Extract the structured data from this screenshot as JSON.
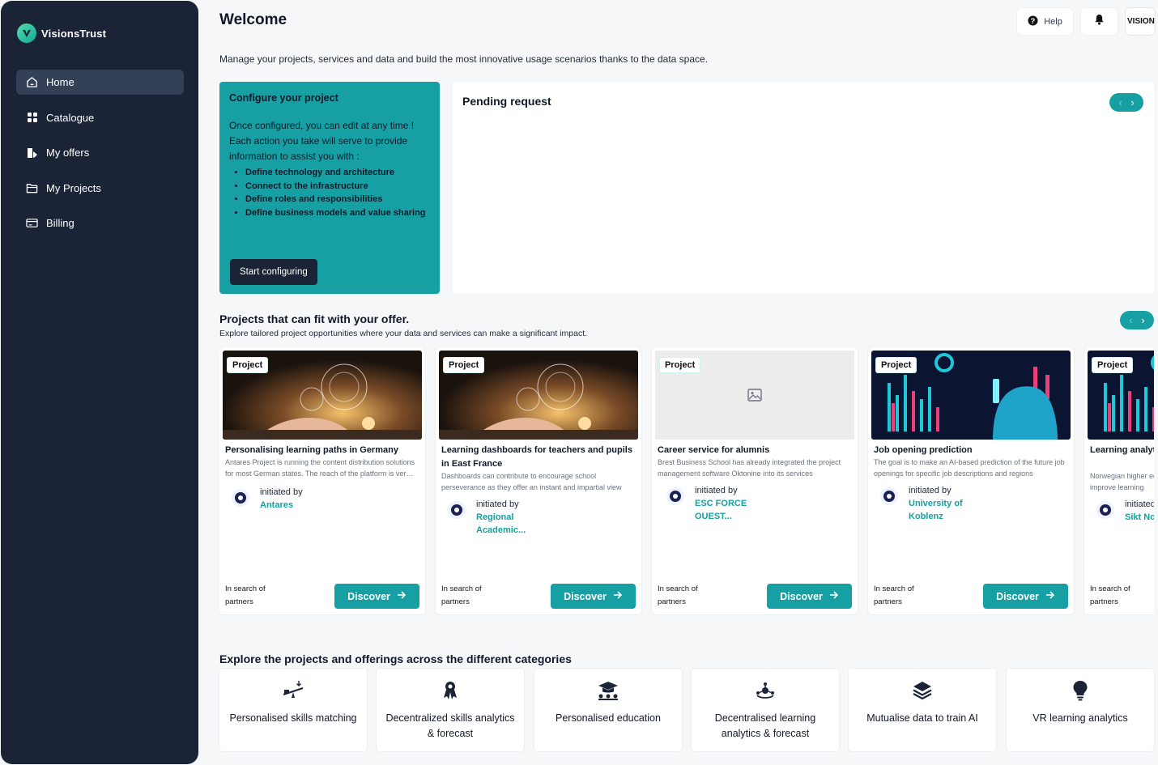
{
  "app": {
    "name": "VisionsTrust"
  },
  "sidebar": {
    "items": [
      {
        "label": "Home",
        "icon": "home-icon"
      },
      {
        "label": "Catalogue",
        "icon": "grid-icon"
      },
      {
        "label": "My offers",
        "icon": "offers-icon"
      },
      {
        "label": "My Projects",
        "icon": "folder-icon"
      },
      {
        "label": "Billing",
        "icon": "billing-icon"
      }
    ],
    "active_index": 0
  },
  "header": {
    "title": "Welcome",
    "subtitle": "Manage your projects, services and data and build the most innovative usage scenarios thanks to the data space.",
    "help_label": "Help",
    "avatar_text": "VISIONS"
  },
  "configure": {
    "title": "Configure your project",
    "text1": "Once configured, you can edit at any time !",
    "text2": "Each action you take will serve to provide information to assist you with :",
    "bullets": [
      "Define technology and architecture",
      "Connect to the infrastructure",
      "Define roles and responsibilities",
      "Define business models and value sharing"
    ],
    "button": "Start configuring"
  },
  "pending": {
    "title": "Pending request"
  },
  "projects": {
    "title": "Projects that can fit with your offer.",
    "subtitle": "Explore tailored project opportunities where your data and services can make a significant impact.",
    "initiated_label": "initiated by",
    "search_label": "In search of partners",
    "discover_label": "Discover",
    "cards": [
      {
        "badge": "Project",
        "title": "Personalising learning paths in Germany",
        "desc": "Antares Project is running the content distribution solutions for most German states. The reach of the platform is very large",
        "org": "Antares",
        "image": "hands-laptop"
      },
      {
        "badge": "Project",
        "title": "Learning dashboards for teachers and pupils in East France",
        "desc": "Dashboards can contribute to encourage school perseverance as they offer an instant and impartial view",
        "org": "Regional Academic...",
        "image": "hands-laptop"
      },
      {
        "badge": "Project",
        "title": "Career service for alumnis",
        "desc": "Brest Business School has already integrated the project management software Oktonine into its services",
        "org": "ESC FORCE OUEST...",
        "image": "placeholder"
      },
      {
        "badge": "Project",
        "title": "Job opening prediction",
        "desc": "The goal is to make an AI-based prediction of the future job openings for specific job descriptions and regions",
        "org": "University of Koblenz",
        "image": "data-person"
      },
      {
        "badge": "Project",
        "title": "Learning analytics Norwegian universities",
        "desc": "Norwegian higher education institutions are using AI to improve learning",
        "org": "Sikt Norway",
        "image": "data-person"
      }
    ]
  },
  "categories": {
    "title": "Explore the projects and offerings across the different categories",
    "items": [
      {
        "label": "Personalised skills matching",
        "icon": "seesaw-icon"
      },
      {
        "label": "Decentralized skills analytics & forecast",
        "icon": "award-icon"
      },
      {
        "label": "Personalised education",
        "icon": "graduation-icon"
      },
      {
        "label": "Decentralised learning analytics & forecast",
        "icon": "network-icon"
      },
      {
        "label": "Mutualise data to train AI",
        "icon": "layers-icon"
      },
      {
        "label": "VR learning analytics",
        "icon": "lightbulb-icon"
      }
    ]
  },
  "colors": {
    "accent": "#16a0a4",
    "sidebar": "#1b2437",
    "background": "#f6f7f9"
  }
}
